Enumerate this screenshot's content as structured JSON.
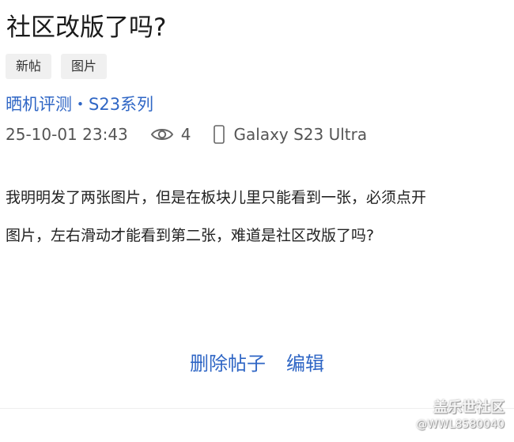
{
  "post": {
    "title": "社区改版了吗?",
    "tags": [
      "新帖",
      "图片"
    ],
    "category": "晒机评测・S23系列",
    "date": "25-10-01 23:43",
    "views": "4",
    "device": "Galaxy S23 Ultra",
    "body_lines": [
      "我明明发了两张图片，但是在板块儿里只能看到一张，必须点开",
      "图片，左右滑动才能看到第二张，难道是社区改版了吗?"
    ]
  },
  "actions": {
    "delete_label": "删除帖子",
    "edit_label": "编辑"
  },
  "watermark": {
    "brand": "盖乐世社区",
    "user": "@WWL8580040"
  },
  "icons": {
    "views": "eye-icon",
    "device": "phone-icon"
  },
  "colors": {
    "accent": "#2f66c5",
    "tag_bg": "#f0f0f0",
    "meta_text": "#555555"
  }
}
